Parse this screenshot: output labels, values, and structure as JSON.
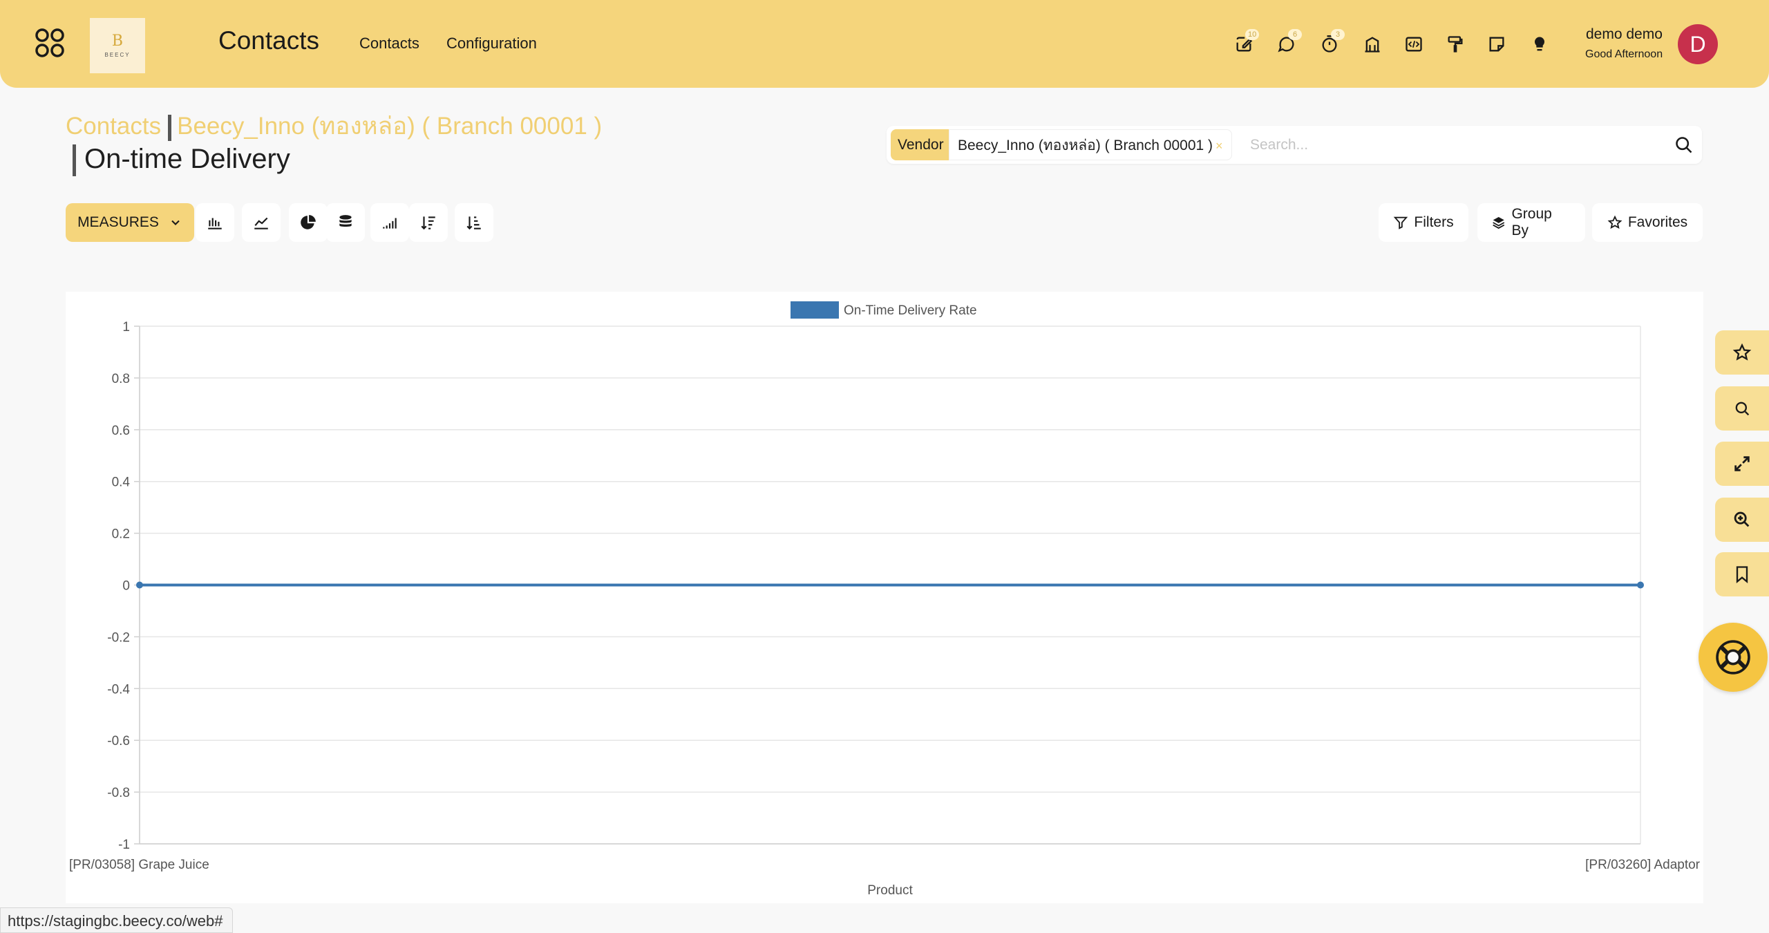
{
  "navbar": {
    "app_title": "Contacts",
    "logo_letter": "B",
    "logo_text": "BEECY",
    "menu": [
      "Contacts",
      "Configuration"
    ],
    "systray": [
      {
        "icon": "edit-icon",
        "badge": "10"
      },
      {
        "icon": "chat-icon",
        "badge": "6"
      },
      {
        "icon": "timer-icon",
        "badge": "3"
      },
      {
        "icon": "bank-icon",
        "badge": ""
      },
      {
        "icon": "code-icon",
        "badge": ""
      },
      {
        "icon": "paint-roller-icon",
        "badge": ""
      },
      {
        "icon": "note-icon",
        "badge": ""
      },
      {
        "icon": "lightbulb-icon",
        "badge": ""
      }
    ],
    "user_name": "demo demo",
    "greeting": "Good Afternoon",
    "avatar_letter": "D"
  },
  "breadcrumb": {
    "root": "Contacts",
    "record": "Beecy_Inno (ทองหล่อ)  ( Branch 00001 )",
    "current": "On-time Delivery"
  },
  "search": {
    "facet_label": "Vendor",
    "facet_value": "Beecy_Inno (ทองหล่อ) ( Branch 00001 )",
    "placeholder": "Search..."
  },
  "toolbar": {
    "measures_label": "MEASURES",
    "view_buttons": [
      "bar-chart-icon",
      "line-chart-icon",
      "pie-chart-icon",
      "stacked-icon",
      "cumulative-icon",
      "sort-descending-icon",
      "sort-ascending-icon"
    ],
    "filters_label": "Filters",
    "groupby_label": "Group By",
    "favorites_label": "Favorites"
  },
  "chart_data": {
    "type": "line",
    "legend": [
      "On-Time Delivery Rate"
    ],
    "legend_position": "top",
    "series": [
      {
        "name": "On-Time Delivery Rate",
        "color": "#3a76b0",
        "values": [
          0,
          0
        ]
      }
    ],
    "categories": [
      "[PR/03058] Grape Juice",
      "[PR/03260] Adaptor"
    ],
    "xlabel": "Product",
    "ylabel": "",
    "ylim": [
      -1,
      1
    ],
    "yticks": [
      "1",
      "0.8",
      "0.6",
      "0.4",
      "0.2",
      "0",
      "-0.2",
      "-0.4",
      "-0.6",
      "-0.8",
      "-1"
    ],
    "grid": true
  },
  "floating": [
    "star-icon",
    "search-icon",
    "expand-icon",
    "zoom-in-icon",
    "bookmark-icon"
  ],
  "status_url": "https://stagingbc.beecy.co/web#",
  "colors": {
    "accent": "#f5d57c",
    "series": "#3a76b0",
    "avatar": "#c7304c"
  }
}
